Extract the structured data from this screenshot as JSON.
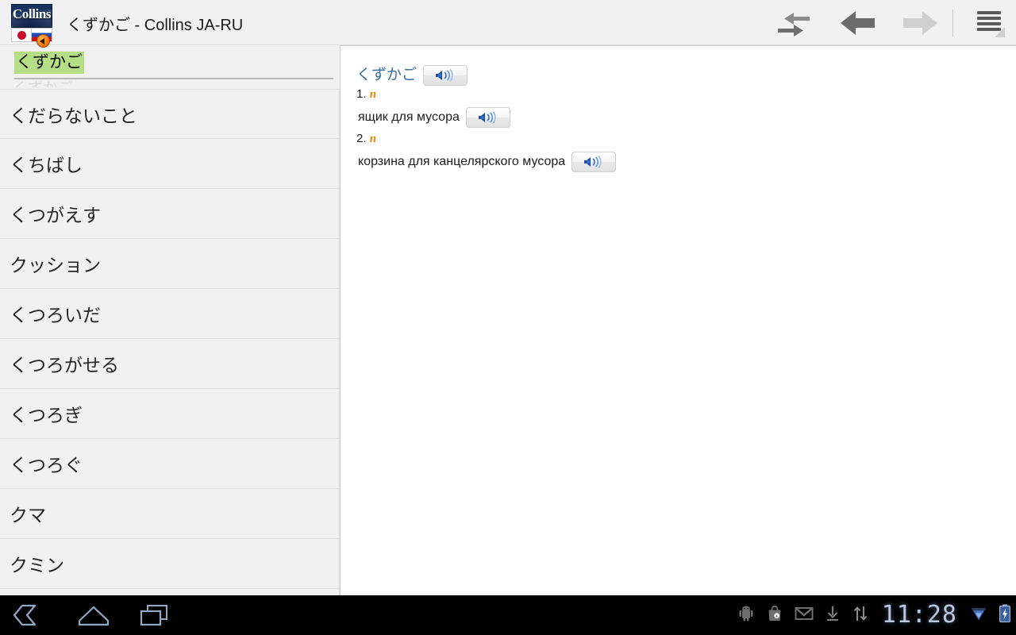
{
  "app": {
    "title": "くずかご - Collins JA-RU",
    "logo": {
      "word": "Collins",
      "badge_icon": "speaker-badge-icon",
      "flag_source": "japan-flag-icon",
      "flag_target": "russia-flag-icon"
    }
  },
  "toolbar": {
    "swap_languages_label": "swap-languages-icon",
    "back_label": "back-arrow-icon",
    "forward_label": "forward-arrow-icon",
    "menu_label": "menu-icon"
  },
  "search": {
    "value": "くずかご",
    "placeholder": "",
    "ghost_row": "くずかご"
  },
  "wordlist": {
    "items": [
      {
        "label": "くだらないこと"
      },
      {
        "label": "くちばし"
      },
      {
        "label": "くつがえす"
      },
      {
        "label": "クッション"
      },
      {
        "label": "くつろいだ"
      },
      {
        "label": "くつろがせる"
      },
      {
        "label": "くつろぎ"
      },
      {
        "label": "くつろぐ"
      },
      {
        "label": "クマ"
      },
      {
        "label": "クミン"
      }
    ]
  },
  "entry": {
    "headword": "くずかご",
    "headword_audio": "speaker-icon",
    "senses": [
      {
        "number": "1.",
        "pos": "n",
        "definition": "ящик для мусора",
        "audio": "speaker-icon"
      },
      {
        "number": "2.",
        "pos": "n",
        "definition": "корзина для канцелярского мусора",
        "audio": "speaker-icon"
      }
    ]
  },
  "statusbar": {
    "clock": "11:28",
    "icons": [
      "android-robot-icon",
      "play-store-icon",
      "gmail-icon",
      "download-icon",
      "sync-icon",
      "signal-icon",
      "battery-charging-icon"
    ]
  },
  "navbar": {
    "back": "android-back-icon",
    "home": "android-home-icon",
    "recents": "android-recents-icon"
  },
  "colors": {
    "accent_headword": "#3c6ea5",
    "pos_orange": "#f08000",
    "selection_green": "#b5de86",
    "panel_bg": "#f1f1f1"
  }
}
